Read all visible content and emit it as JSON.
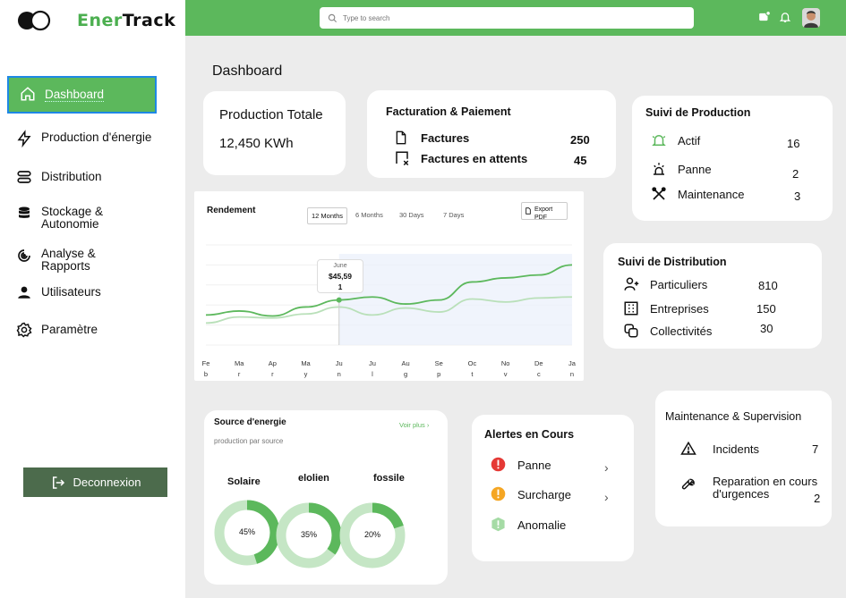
{
  "brand": {
    "part1": "Ener",
    "part2": "Track"
  },
  "colors": {
    "accent": "#5cb85c",
    "dark_accent": "#4c6b4c",
    "selection": "#1e88e5"
  },
  "sidebar": {
    "items": [
      {
        "label": "Dashboard",
        "icon": "home-icon"
      },
      {
        "label": "Production d'énergie",
        "icon": "lightning-icon"
      },
      {
        "label": "Distribution",
        "icon": "server-icon"
      },
      {
        "label": "Stockage &\nAutonomie",
        "icon": "database-icon"
      },
      {
        "label": "Analyse &\nRapports",
        "icon": "analytics-icon"
      },
      {
        "label": "Utilisateurs",
        "icon": "user-icon"
      },
      {
        "label": "Paramètre",
        "icon": "gear-icon"
      }
    ],
    "logout_label": "Deconnexion"
  },
  "search": {
    "placeholder": "Type to search"
  },
  "page_title": "Dashboard",
  "production": {
    "title": "Production Totale",
    "value": "12,450 KWh"
  },
  "billing": {
    "title": "Facturation & Paiement",
    "rows": [
      {
        "label": "Factures",
        "value": "250",
        "icon": "document-icon"
      },
      {
        "label": "Factures en attents",
        "value": "45",
        "icon": "pending-invoice-icon"
      }
    ]
  },
  "production_tracking": {
    "title": "Suivi de Production",
    "rows": [
      {
        "label": "Actif",
        "value": "16",
        "icon": "bell-icon"
      },
      {
        "label": "Panne",
        "value": "2",
        "icon": "alarm-icon"
      },
      {
        "label": "Maintenance",
        "value": "3",
        "icon": "tools-icon"
      }
    ]
  },
  "distribution": {
    "title": "Suivi de Distribution",
    "rows": [
      {
        "label": "Particuliers",
        "value": "810",
        "icon": "person-icon"
      },
      {
        "label": "Entreprises",
        "value": "150",
        "icon": "building-icon"
      },
      {
        "label": "Collectivités",
        "value": "30",
        "icon": "group-icon"
      }
    ]
  },
  "chart": {
    "title": "Rendement",
    "tabs": [
      "12 Months",
      "6 Months",
      "30 Days",
      "7 Days"
    ],
    "active_tab": "12 Months",
    "export_label": "Export\nPDF",
    "tooltip": {
      "month": "June",
      "value": "$45,591"
    }
  },
  "chart_data": {
    "type": "line",
    "title": "Rendement",
    "x": [
      "Feb",
      "Mar",
      "Apr",
      "May",
      "Jun",
      "Jul",
      "Aug",
      "Sep",
      "Oct",
      "Nov",
      "Dec",
      "Jan"
    ],
    "x_display": [
      "Fe\nb",
      "Ma\nr",
      "Ap\nr",
      "Ma\ny",
      "Ju\nn",
      "Ju\nl",
      "Au\ng",
      "Se\np",
      "Oc\nt",
      "No\nv",
      "De\nc",
      "Ja\nn"
    ],
    "series": [
      {
        "values": [
          30,
          34,
          29,
          38,
          45,
          48,
          41,
          45,
          63,
          67,
          70,
          80
        ],
        "color": "#5cb85c"
      },
      {
        "values": [
          22,
          28,
          27,
          31,
          38,
          30,
          37,
          33,
          46,
          43,
          47,
          48
        ],
        "color": "#b9e0b9"
      }
    ],
    "ylim": [
      0,
      100
    ],
    "grid": true,
    "highlight": {
      "index": 4,
      "label": "June",
      "value": "$45,591"
    }
  },
  "energy_source": {
    "title": "Source d'energie",
    "subtitle": "production par source",
    "see_more": "Voir plus",
    "donuts": [
      {
        "label": "Solaire",
        "percent": 45,
        "display": "45%"
      },
      {
        "label": "elolien",
        "percent": 35,
        "display": "35%"
      },
      {
        "label": "fossile",
        "percent": 20,
        "display": "20%"
      }
    ]
  },
  "alerts": {
    "title": "Alertes en Cours",
    "items": [
      {
        "label": "Panne",
        "color": "#e53935"
      },
      {
        "label": "Surcharge",
        "color": "#f5a623"
      },
      {
        "label": "Anomalie",
        "color": "#a5dba5"
      }
    ]
  },
  "maintenance": {
    "title": "Maintenance & Supervision",
    "rows": [
      {
        "label": "Incidents",
        "value": "7",
        "icon": "warning-icon"
      },
      {
        "label": "Reparation en cours\nd'urgences",
        "value": "2",
        "icon": "wrench-icon"
      }
    ]
  }
}
